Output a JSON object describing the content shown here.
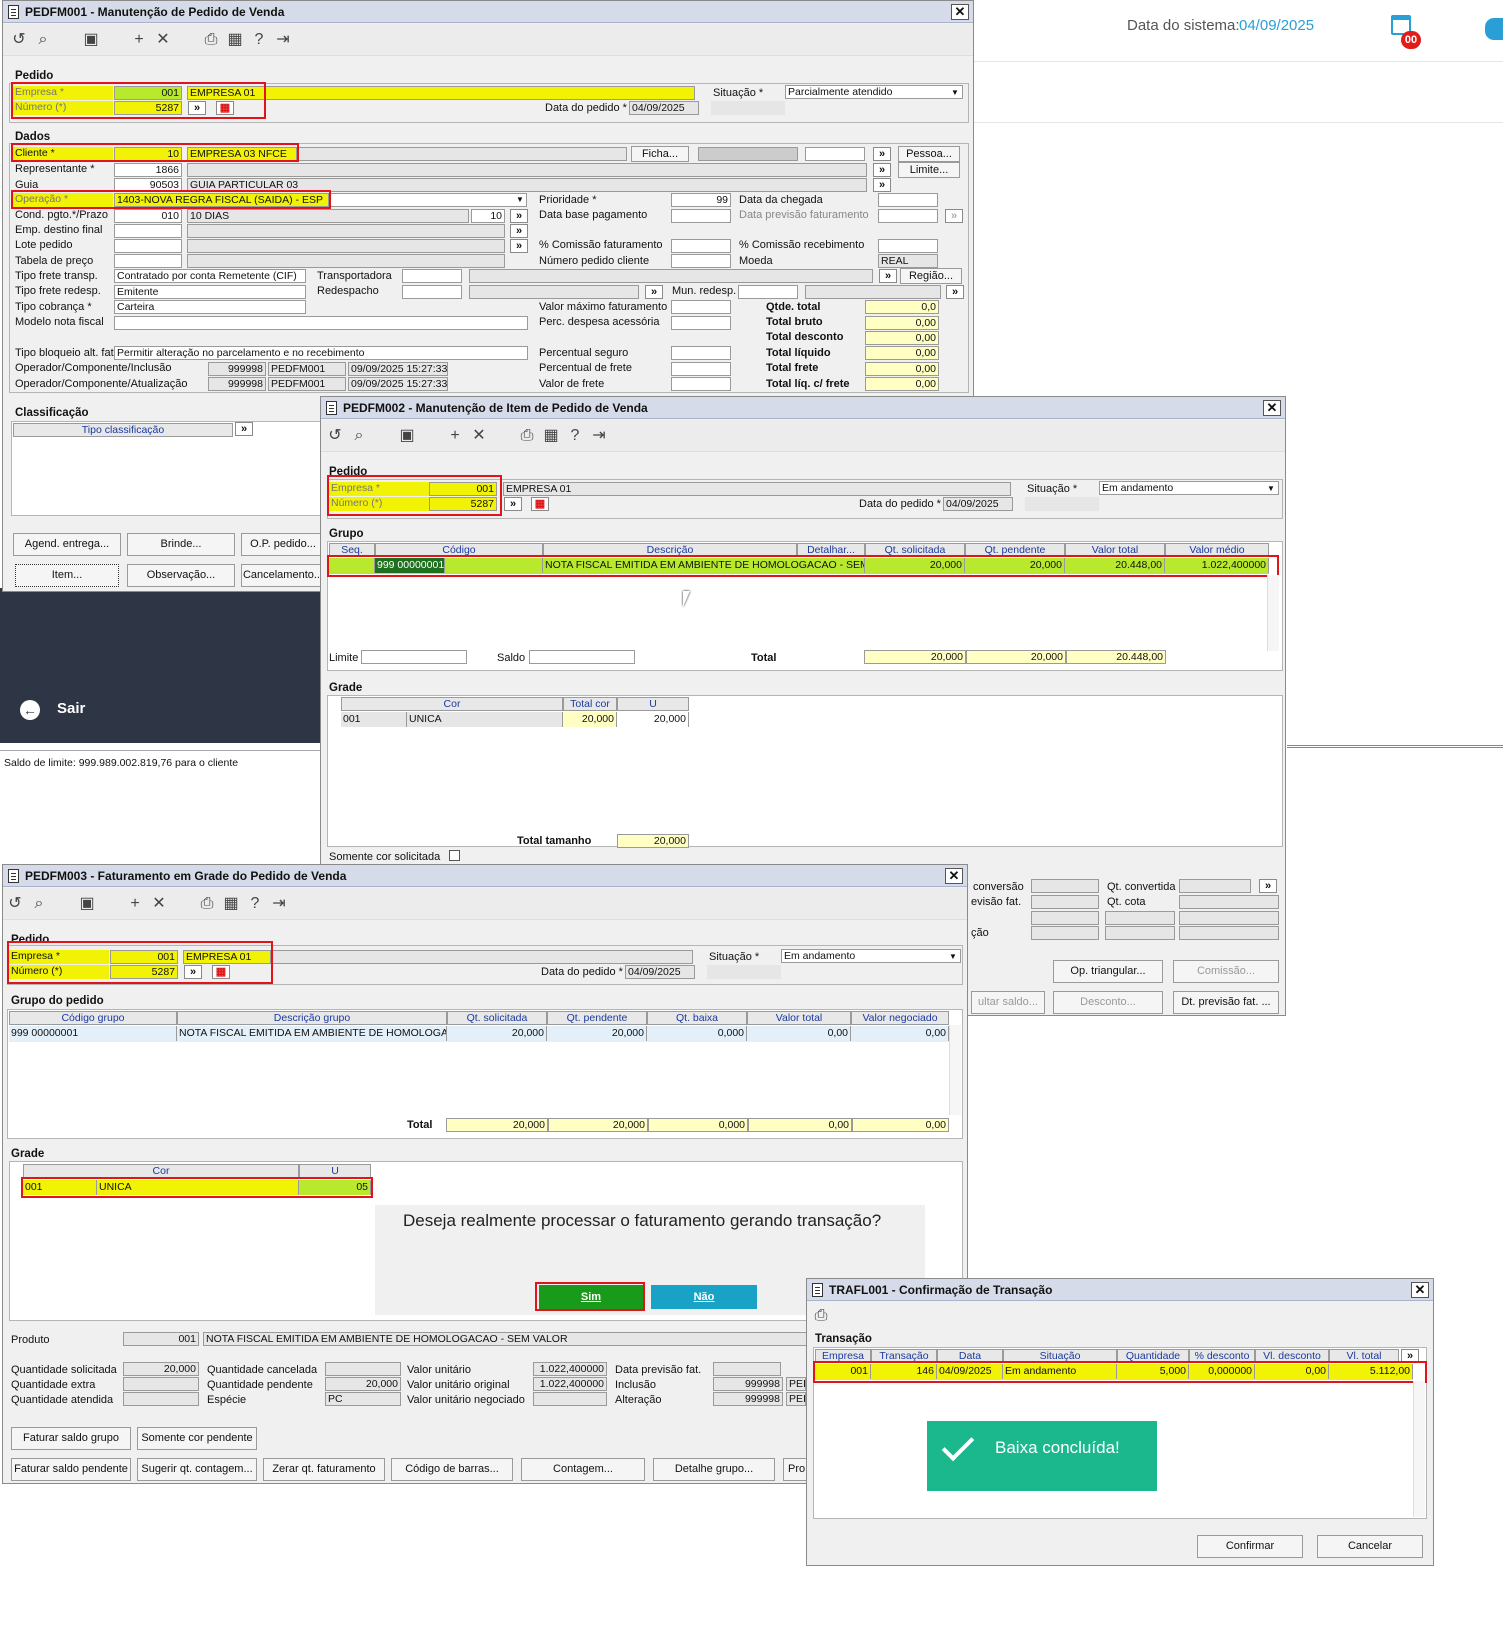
{
  "header": {
    "system_date_label": "Data do sistema:",
    "system_date": "04/09/2025",
    "badge": "00"
  },
  "status_bar": {
    "text": "Saldo de limite: 999.989.002.819,76 para o cliente"
  },
  "side_menu": {
    "sair": "Sair"
  },
  "w1": {
    "title": "PEDFM001 - Manutenção de Pedido de Venda",
    "pedido": "Pedido",
    "empresa_label": "Empresa *",
    "empresa_code": "001",
    "empresa_name": "EMPRESA 01",
    "numero_label": "Número (*)",
    "numero": "5287",
    "data_label": "Data do pedido *",
    "data": "04/09/2025",
    "situacao_label": "Situação *",
    "situacao": "Parcialmente atendido",
    "dados": "Dados",
    "cliente_label": "Cliente *",
    "cliente_code": "10",
    "cliente_name": "EMPRESA 03 NFCE",
    "ficha": "Ficha...",
    "pessoa": "Pessoa...",
    "limite": "Limite...",
    "rep_label": "Representante *",
    "rep_code": "1866",
    "guia_label": "Guia",
    "guia_code": "90503",
    "guia_name": "GUIA PARTICULAR 03",
    "operacao_label": "Operação *",
    "operacao": "1403-NOVA REGRA FISCAL (SAIDA) - ESP",
    "cond_label": "Cond. pgto.*/Prazo",
    "cond_code": "010",
    "cond_name": "10 DIAS",
    "cond_prazo": "10",
    "emp_dest_label": "Emp. destino final",
    "lote_label": "Lote pedido",
    "tabela_label": "Tabela de preço",
    "tipo_frete_label": "Tipo frete transp.",
    "tipo_frete": "Contratado por conta Remetente (CIF)",
    "tipo_frete_redesp_label": "Tipo frete redesp.",
    "tipo_frete_redesp": "Emitente",
    "tipo_cobranca_label": "Tipo cobrança *",
    "tipo_cobranca": "Carteira",
    "modelo_label": "Modelo nota fiscal",
    "transportadora_label": "Transportadora",
    "redespacho_label": "Redespacho",
    "mun_redesp_label": "Mun. redesp.",
    "regiao": "Região...",
    "prioridade_label": "Prioridade *",
    "prioridade": "99",
    "data_base_label": "Data base pagamento",
    "data_chegada_label": "Data da chegada",
    "data_prev_fat_label": "Data previsão faturamento",
    "comissao_fat_label": "% Comissão faturamento",
    "comissao_rec_label": "% Comissão recebimento",
    "num_ped_cli_label": "Número pedido cliente",
    "moeda_label": "Moeda",
    "moeda": "REAL",
    "valor_max_label": "Valor máximo faturamento",
    "perc_desp_label": "Perc. despesa acessória",
    "perc_seguro_label": "Percentual seguro",
    "perc_frete_label": "Percentual de frete",
    "valor_frete_label": "Valor de frete",
    "qtde_total_label": "Qtde. total",
    "qtde_total": "0,0",
    "total_bruto_label": "Total bruto",
    "total_bruto": "0,00",
    "total_desconto_label": "Total desconto",
    "total_desconto": "0,00",
    "total_liquido_label": "Total líquido",
    "total_liquido": "0,00",
    "total_frete_label": "Total frete",
    "total_frete": "0,00",
    "total_liq_frete_label": "Total líq. c/ frete",
    "total_liq_frete": "0,00",
    "tipo_bloqueio_label": "Tipo bloqueio alt. fat.",
    "tipo_bloqueio": "Permitir alteração no parcelamento e no recebimento",
    "op_inclusao_label": "Operador/Componente/Inclusão",
    "op_atualizacao_label": "Operador/Componente/Atualização",
    "op_code": "999998",
    "op_comp": "PEDFM001",
    "op_inc_date": "09/09/2025 15:27:33",
    "op_at_date": "09/09/2025 15:27:33",
    "classificacao": "Classificação",
    "tipo_classificacao": "Tipo classificação",
    "agend": "Agend. entrega...",
    "brinde": "Brinde...",
    "op_pedido": "O.P. pedido...",
    "item": "Item...",
    "observacao": "Observação...",
    "cancelamento": "Cancelamento..."
  },
  "w2": {
    "title": "PEDFM002 - Manutenção de Item de Pedido de Venda",
    "pedido": "Pedido",
    "empresa_label": "Empresa *",
    "empresa_code": "001",
    "empresa_name": "EMPRESA 01",
    "numero_label": "Número (*)",
    "numero": "5287",
    "data_label": "Data do pedido *",
    "data": "04/09/2025",
    "situacao_label": "Situação *",
    "situacao": "Em andamento",
    "grupo": "Grupo",
    "cols": [
      "Seq.",
      "Código",
      "Descrição",
      "Detalhar...",
      "Qt. solicitada",
      "Qt. pendente",
      "Valor total",
      "Valor médio"
    ],
    "row": {
      "codigo": "999 00000001",
      "descricao": "NOTA FISCAL EMITIDA EM AMBIENTE DE HOMOLOGACAO - SEM VALOR",
      "qt_solicitada": "20,000",
      "qt_pendente": "20,000",
      "valor_total": "20.448,00",
      "valor_medio": "1.022,400000"
    },
    "limite_label": "Limite",
    "saldo_label": "Saldo",
    "total_label": "Total",
    "total_sol": "20,000",
    "total_pend": "20,000",
    "total_valor": "20.448,00",
    "grade": "Grade",
    "grade_cols": [
      "Cor",
      "Total cor",
      "U"
    ],
    "grade_row": {
      "code": "001",
      "cor": "UNICA",
      "total_cor": "20,000",
      "u": "20,000"
    },
    "total_tamanho_label": "Total tamanho",
    "total_tamanho": "20,000",
    "somente_cor": "Somente cor solicitada",
    "conversao": "conversão",
    "qt_convertida": "Qt. convertida",
    "previsao_fat": "evisão fat.",
    "qt_cota": "Qt. cota",
    "cao": "ção",
    "op_triangular": "Op. triangular...",
    "comissao": "Comissão...",
    "consultar_saldo": "ultar saldo...",
    "desconto": "Desconto...",
    "dt_prev_fat": "Dt. previsão fat. ..."
  },
  "w3": {
    "title": "PEDFM003 - Faturamento em Grade do Pedido de Venda",
    "pedido": "Pedido",
    "empresa_label": "Empresa *",
    "empresa_code": "001",
    "empresa_name": "EMPRESA 01",
    "numero_label": "Número (*)",
    "numero": "5287",
    "data_label": "Data do pedido *",
    "data": "04/09/2025",
    "situacao_label": "Situação *",
    "situacao": "Em andamento",
    "grupo_pedido": "Grupo do pedido",
    "cols": [
      "Código grupo",
      "Descrição grupo",
      "Qt. solicitada",
      "Qt. pendente",
      "Qt. baixa",
      "Valor total",
      "Valor  negociado"
    ],
    "row": {
      "codigo": "999 00000001",
      "descricao": "NOTA FISCAL EMITIDA EM AMBIENTE DE HOMOLOGACAO",
      "qt_sol": "20,000",
      "qt_pend": "20,000",
      "qt_baixa": "0,000",
      "valor_total": "0,00",
      "valor_neg": "0,00"
    },
    "total_label": "Total",
    "tot_sol": "20,000",
    "tot_pend": "20,000",
    "tot_baixa": "0,000",
    "tot_valor": "0,00",
    "tot_neg": "0,00",
    "grade": "Grade",
    "grade_cols": [
      "Cor",
      "U"
    ],
    "grade_row": {
      "code": "001",
      "cor": "UNICA",
      "u": "05"
    },
    "dialog_text": "Deseja realmente processar o faturamento gerando transação?",
    "sim": "Sim",
    "nao": "Não",
    "produto_label": "Produto",
    "produto_code": "001",
    "produto_desc": "NOTA FISCAL EMITIDA EM AMBIENTE DE HOMOLOGACAO - SEM VALOR",
    "qtd_sol_label": "Quantidade solicitada",
    "qtd_sol": "20,000",
    "qtd_extra_label": "Quantidade extra",
    "qtd_atendida_label": "Quantidade atendida",
    "qtd_canc_label": "Quantidade cancelada",
    "qtd_pend_label": "Quantidade pendente",
    "qtd_pend": "20,000",
    "especie_label": "Espécie",
    "especie": "PC",
    "vu_label": "Valor unitário",
    "vu": "1.022,400000",
    "vuo_label": "Valor unitário original",
    "vuo": "1.022,400000",
    "vun_label": "Valor unitário negociado",
    "dpf_label": "Data previsão fat.",
    "inclusao_label": "Inclusão",
    "alteracao_label": "Alteração",
    "inc_op": "999998",
    "alt_op": "999998",
    "pe": "PEI",
    "b_faturar_saldo_grupo": "Faturar saldo grupo",
    "b_somente_cor": "Somente cor pendente",
    "b_faturar_saldo_pend": "Faturar saldo pendente",
    "b_sugerir": "Sugerir qt. contagem...",
    "b_zerar": "Zerar qt. faturamento",
    "b_codigo_barras": "Código de barras...",
    "b_contagem": "Contagem...",
    "b_detalhe": "Detalhe grupo...",
    "b_pro": "Pro"
  },
  "w4": {
    "title": "TRAFL001 - Confirmação de Transação",
    "transacao": "Transação",
    "cols": [
      "Empresa",
      "Transação",
      "Data",
      "Situação",
      "Quantidade",
      "% desconto",
      "Vl. desconto",
      "Vl. total"
    ],
    "row": {
      "empresa": "001",
      "transacao": "146",
      "data": "04/09/2025",
      "situacao": "Em andamento",
      "quantidade": "5,000",
      "perc_desc": "0,000000",
      "vl_desc": "0,00",
      "vl_total": "5.112,00"
    },
    "toast": "Baixa concluída!",
    "confirmar": "Confirmar",
    "cancelar": "Cancelar"
  }
}
